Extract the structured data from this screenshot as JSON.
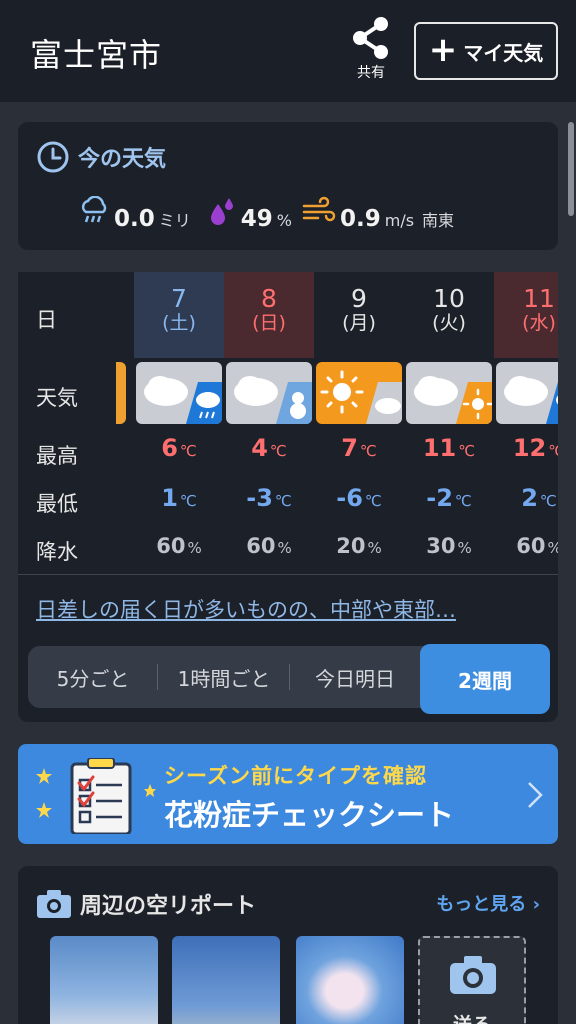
{
  "header": {
    "city": "富士宮市",
    "share_label": "共有",
    "my_weather_label": "マイ天気"
  },
  "now": {
    "title": "今の天気",
    "precip_value": "0.0",
    "precip_unit": "ミリ",
    "humidity_value": "49",
    "humidity_unit": "%",
    "wind_value": "0.9",
    "wind_unit": "m/s",
    "wind_dir": "南東"
  },
  "forecast": {
    "row_labels": {
      "day": "日",
      "weather": "天気",
      "high": "最高",
      "low": "最低",
      "precip": "降水"
    },
    "temp_unit": "℃",
    "precip_unit": "%",
    "days": [
      {
        "date": "7",
        "weekday": "(土)",
        "weather": "cloudy-then-rain",
        "high": "6",
        "low": "1",
        "precip": "60"
      },
      {
        "date": "8",
        "weekday": "(日)",
        "weather": "cloudy-then-snow",
        "high": "4",
        "low": "-3",
        "precip": "60"
      },
      {
        "date": "9",
        "weekday": "(月)",
        "weather": "sunny-then-cloudy",
        "high": "7",
        "low": "-6",
        "precip": "20"
      },
      {
        "date": "10",
        "weekday": "(火)",
        "weather": "cloudy-then-sunny",
        "high": "11",
        "low": "-2",
        "precip": "30"
      },
      {
        "date": "11",
        "weekday": "(水)",
        "weather": "cloudy-then-rain",
        "high": "12",
        "low": "2",
        "precip": "60"
      }
    ],
    "summary": "日差しの届く日が多いものの、中部や東部…",
    "tabs": [
      "5分ごと",
      "1時間ごと",
      "今日明日",
      "2週間"
    ],
    "active_tab": "2週間"
  },
  "banner": {
    "line1": "シーズン前にタイプを確認",
    "line2": "花粉症チェックシート"
  },
  "reports": {
    "title": "周辺の空リポート",
    "more_label": "もっと見る",
    "send_label": "送る"
  },
  "colors": {
    "saturday": "#2e3b52",
    "sunday": "#4a2a2f",
    "accent": "#3d8de0",
    "high": "#ff6f6f",
    "low": "#74a8ef"
  }
}
